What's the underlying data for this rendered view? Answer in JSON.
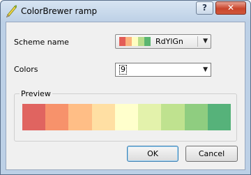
{
  "window": {
    "title": "ColorBrewer ramp",
    "help_glyph": "?",
    "close_glyph": "✕"
  },
  "form": {
    "scheme_label": "Scheme name",
    "colors_label": "Colors",
    "scheme_value": "RdYlGn",
    "scheme_swatch_colors": [
      "#e35d57",
      "#fbb37d",
      "#fffdc1",
      "#b7dd8b",
      "#5bb570"
    ],
    "colors_value": "9"
  },
  "preview": {
    "title": "Preview",
    "colors": [
      "#e06460",
      "#f7926b",
      "#ffbe86",
      "#ffdfa3",
      "#ffffcc",
      "#e3f2ab",
      "#bfe28f",
      "#8fcd80",
      "#56b27a"
    ]
  },
  "buttons": {
    "ok": "OK",
    "cancel": "Cancel"
  },
  "icons": {
    "app": "qgis-pencil-icon",
    "dropdown": "chevron-down-icon"
  }
}
